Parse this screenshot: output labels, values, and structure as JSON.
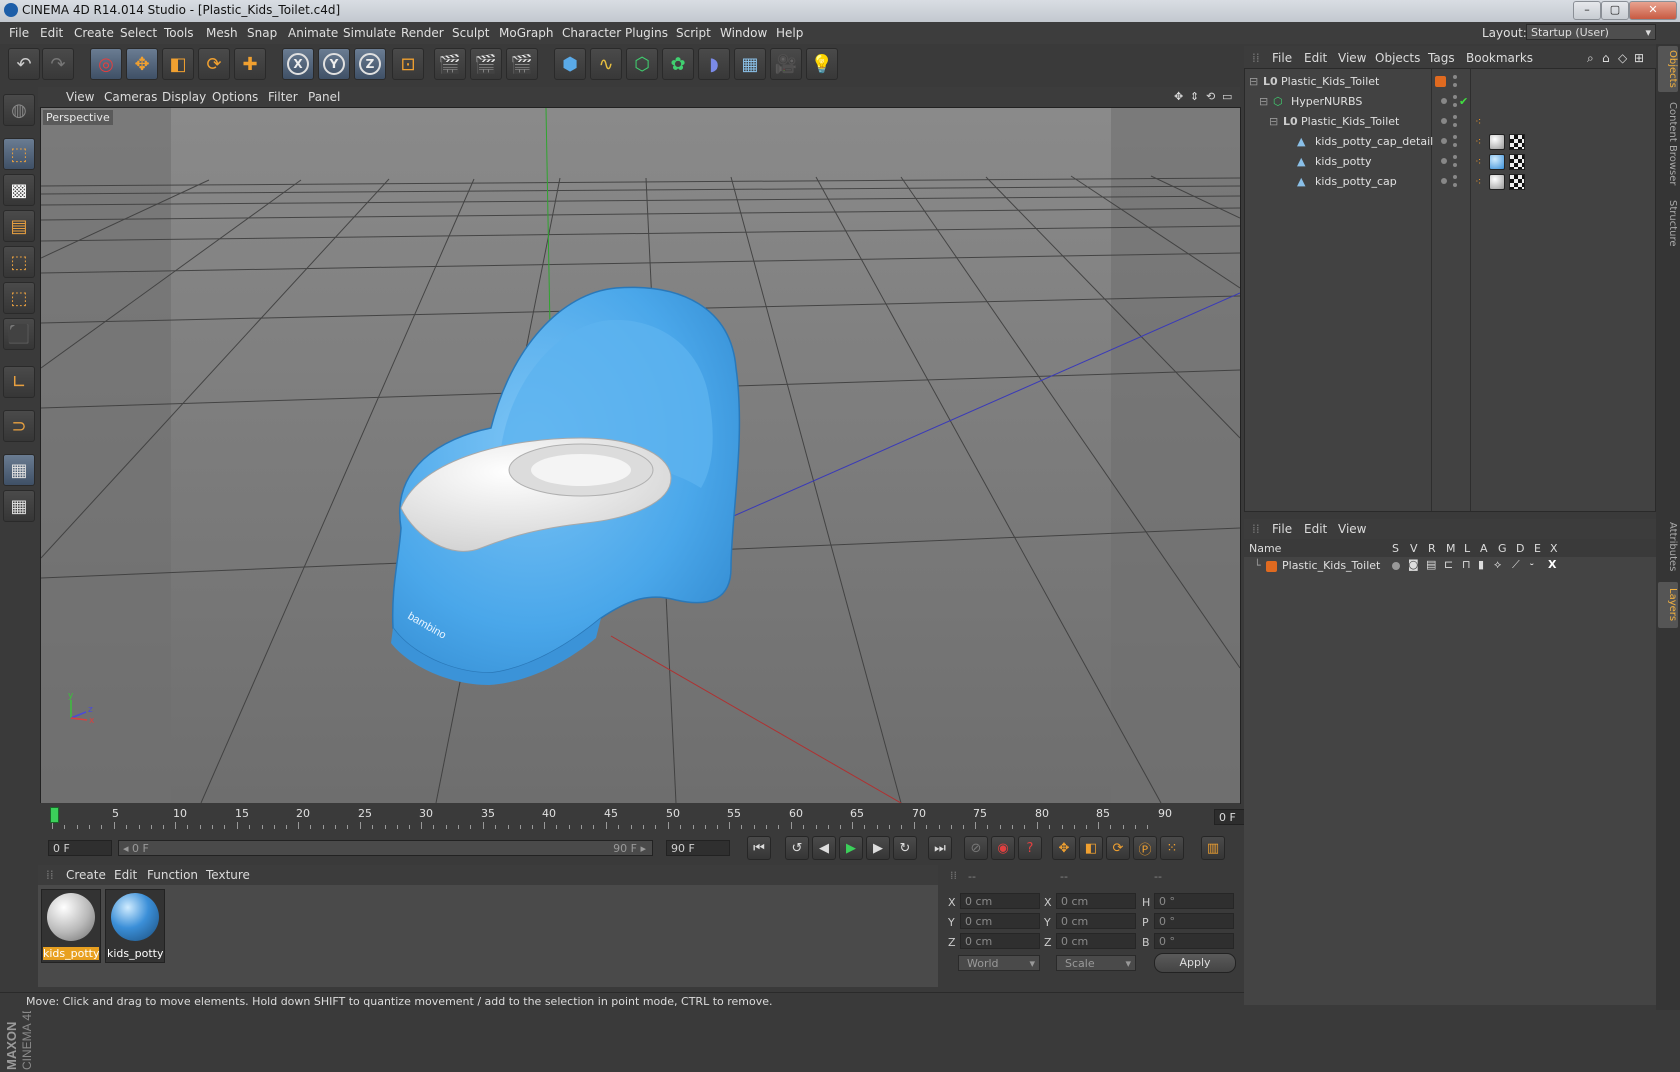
{
  "window": {
    "title": "CINEMA 4D R14.014 Studio - [Plastic_Kids_Toilet.c4d]",
    "buttons": [
      "–",
      "▢",
      "✕"
    ]
  },
  "menubar": {
    "items": [
      "File",
      "Edit",
      "Create",
      "Select",
      "Tools",
      "Mesh",
      "Snap",
      "Animate",
      "Simulate",
      "Render",
      "Sculpt",
      "MoGraph",
      "Character",
      "Plugins",
      "Script",
      "Window",
      "Help"
    ],
    "layout_label": "Layout:",
    "layout_value": "Startup (User)"
  },
  "toolbar": {
    "axis_x": "X",
    "axis_y": "Y",
    "axis_z": "Z"
  },
  "viewport": {
    "menu": [
      "View",
      "Cameras",
      "Display",
      "Options",
      "Filter",
      "Panel"
    ],
    "label": "Perspective",
    "axes": {
      "y": "y",
      "z": "z",
      "x": "x"
    }
  },
  "timeline": {
    "ticks": [
      "0",
      "5",
      "10",
      "15",
      "20",
      "25",
      "30",
      "35",
      "40",
      "45",
      "50",
      "55",
      "60",
      "65",
      "70",
      "75",
      "80",
      "85",
      "90"
    ],
    "current_frame": "0 F"
  },
  "transport": {
    "start_field": "0 F",
    "range_start": "◂ 0 F",
    "range_end": "90 F ▸",
    "end_field": "90 F"
  },
  "material_manager": {
    "menu": [
      "Create",
      "Edit",
      "Function",
      "Texture"
    ],
    "materials": [
      {
        "name": "kids_potty",
        "color": "#e8e8e8",
        "selected": true
      },
      {
        "name": "kids_potty",
        "color": "#3b8fd8",
        "selected": false
      }
    ]
  },
  "coordinates": {
    "headers": [
      "--",
      "--",
      "--"
    ],
    "rows": [
      {
        "axis": "X",
        "pos": "0 cm",
        "axis2": "X",
        "size": "0 cm",
        "rot_label": "H",
        "rot": "0 °"
      },
      {
        "axis": "Y",
        "pos": "0 cm",
        "axis2": "Y",
        "size": "0 cm",
        "rot_label": "P",
        "rot": "0 °"
      },
      {
        "axis": "Z",
        "pos": "0 cm",
        "axis2": "Z",
        "size": "0 cm",
        "rot_label": "B",
        "rot": "0 °"
      }
    ],
    "mode": "World",
    "scale": "Scale",
    "apply": "Apply"
  },
  "status": "Move: Click and drag to move elements. Hold down SHIFT to quantize movement / add to the selection in point mode, CTRL to remove.",
  "object_manager": {
    "menu": [
      "File",
      "Edit",
      "View",
      "Objects",
      "Tags",
      "Bookmarks"
    ],
    "objects": [
      {
        "name": "Plastic_Kids_Toilet",
        "type": "null",
        "depth": 0
      },
      {
        "name": "HyperNURBS",
        "type": "nurbs",
        "depth": 1
      },
      {
        "name": "Plastic_Kids_Toilet",
        "type": "null",
        "depth": 2
      },
      {
        "name": "kids_potty_cap_detail",
        "type": "mesh",
        "depth": 3
      },
      {
        "name": "kids_potty",
        "type": "mesh",
        "depth": 3
      },
      {
        "name": "kids_potty_cap",
        "type": "mesh",
        "depth": 3
      }
    ]
  },
  "layer_manager": {
    "menu": [
      "File",
      "Edit",
      "View"
    ],
    "columns": [
      "Name",
      "S",
      "V",
      "R",
      "M",
      "L",
      "A",
      "G",
      "D",
      "E",
      "X"
    ],
    "layers": [
      {
        "name": "Plastic_Kids_Toilet",
        "color": "#e06a20"
      }
    ]
  },
  "right_tabs": [
    "Objects",
    "Content Browser",
    "Structure",
    "Attributes",
    "Layers"
  ],
  "branding": "MAXON CINEMA 4D"
}
